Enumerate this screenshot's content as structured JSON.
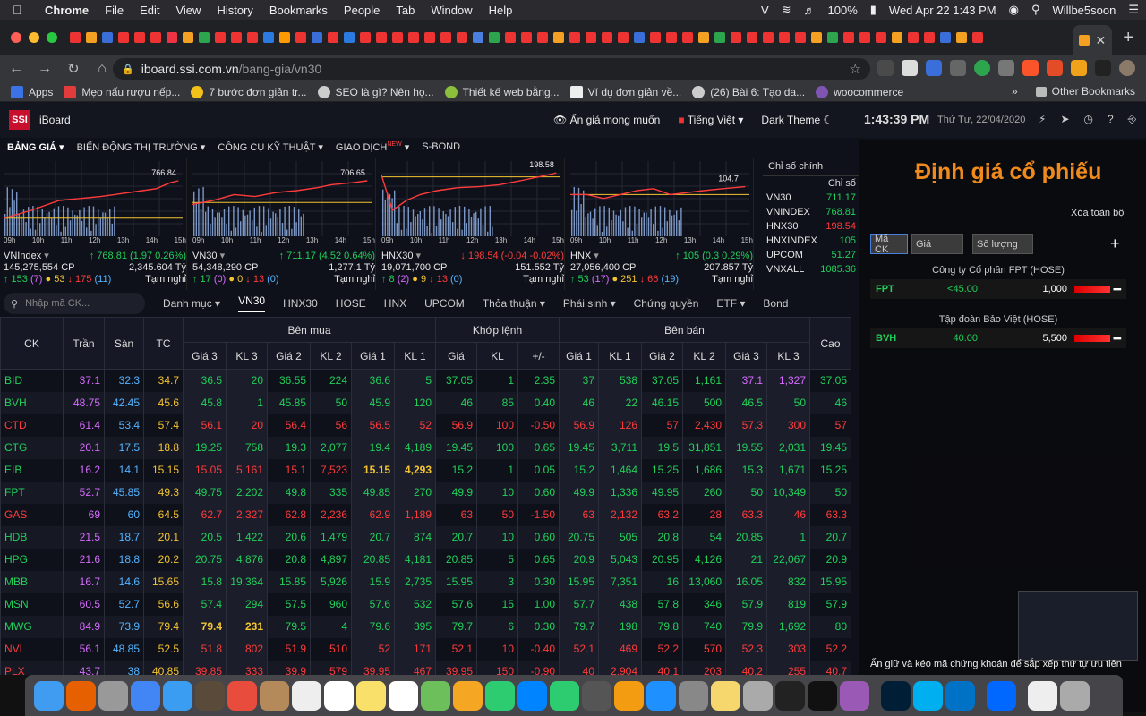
{
  "menubar": {
    "app": "Chrome",
    "items": [
      "File",
      "Edit",
      "View",
      "History",
      "Bookmarks",
      "People",
      "Tab",
      "Window",
      "Help"
    ],
    "battery": "100%",
    "datetime": "Wed Apr 22  1:43 PM",
    "user": "Willbe5soon"
  },
  "browser": {
    "url_host": "iboard.ssi.com.vn",
    "url_path": "/bang-gia/vn30"
  },
  "bookmarks": {
    "items": [
      "Apps",
      "Mẹo nấu rượu nếp...",
      "7 bước đơn giản tr...",
      "SEO là gì? Nên họ...",
      "Thiết kế web bằng...",
      "Ví dụ đơn giản về...",
      "(26) Bài 6: Tạo da...",
      "woocommerce"
    ],
    "more": "»",
    "other": "Other Bookmarks"
  },
  "header": {
    "brand": "iBoard",
    "logo": "SSI",
    "hide_price": "Ẩn giá mong muốn",
    "language": "Tiếng Việt",
    "theme": "Dark Theme",
    "time": "1:43:39 PM",
    "date": "Thứ Tư, 22/04/2020"
  },
  "nav": {
    "items": [
      "BẢNG GIÁ",
      "BIẾN ĐỘNG THỊ TRƯỜNG",
      "CÔNG CỤ KỸ THUẬT",
      "GIAO DỊCH",
      "S-BOND"
    ],
    "new_tag": "NEW"
  },
  "index_charts": [
    {
      "name": "VNIndex",
      "peak": "766.84",
      "change": "↑ 768.81 (1.97 0.26%)",
      "volume": "145,275,554 CP",
      "value": "2,345.604 Tỷ",
      "adv": "↑ 153",
      "adv_ce": "(7)",
      "ref": "53",
      "dec": "↓ 175",
      "dec_fl": "(11)",
      "status": "Tạm nghỉ",
      "ticks": [
        "09h",
        "10h",
        "11h",
        "12h",
        "13h",
        "14h",
        "15h"
      ]
    },
    {
      "name": "VN30",
      "peak": "706.65",
      "change": "↑ 711.17 (4.52 0.64%)",
      "volume": "54,348,290 CP",
      "value": "1,277.1 Tỷ",
      "adv": "↑ 17",
      "adv_ce": "(0)",
      "ref": "0",
      "dec": "↓ 13",
      "dec_fl": "(0)",
      "status": "Tạm nghỉ",
      "ticks": [
        "09h",
        "10h",
        "11h",
        "12h",
        "13h",
        "14h",
        "15h"
      ]
    },
    {
      "name": "HNX30",
      "peak": "198.58",
      "change": "↓ 198.54 (-0.04 -0.02%)",
      "volume": "19,071,700 CP",
      "value": "151.552 Tỷ",
      "adv": "↑ 8",
      "adv_ce": "(2)",
      "ref": "9",
      "dec": "↓ 13",
      "dec_fl": "(0)",
      "status": "Tạm nghỉ",
      "ticks": [
        "09h",
        "10h",
        "11h",
        "12h",
        "13h",
        "14h",
        "15h"
      ]
    },
    {
      "name": "HNX",
      "peak": "104.7",
      "change": "↑ 105 (0.3 0.29%)",
      "volume": "27,056,400 CP",
      "value": "207.857 Tỷ",
      "adv": "↑ 53",
      "adv_ce": "(17)",
      "ref": "251",
      "dec": "↓ 66",
      "dec_fl": "(19)",
      "status": "Tạm nghỉ",
      "ticks": [
        "09h",
        "10h",
        "11h",
        "12h",
        "13h",
        "14h",
        "15h"
      ]
    }
  ],
  "index_panel": {
    "title": "Chỉ số chính",
    "header": "Chỉ số",
    "rows": [
      {
        "name": "VN30",
        "value": "711.17",
        "color": "#21d05a"
      },
      {
        "name": "VNINDEX",
        "value": "768.81",
        "color": "#21d05a"
      },
      {
        "name": "HNX30",
        "value": "198.54",
        "color": "#ff3b3b"
      },
      {
        "name": "HNXINDEX",
        "value": "105",
        "color": "#21d05a"
      },
      {
        "name": "UPCOM",
        "value": "51.27",
        "color": "#21d05a"
      },
      {
        "name": "VNXALL",
        "value": "1085.36",
        "color": "#21d05a"
      }
    ]
  },
  "tabs": {
    "search_placeholder": "Nhập mã CK...",
    "items": [
      "Danh mục",
      "VN30",
      "HNX30",
      "HOSE",
      "HNX",
      "UPCOM",
      "Thỏa thuận",
      "Phái sinh",
      "Chứng quyền",
      "ETF",
      "Bond"
    ]
  },
  "table": {
    "headers": {
      "ck": "CK",
      "tran": "Trần",
      "san": "Sàn",
      "tc": "TC",
      "ben_mua": "Bên mua",
      "khop": "Khớp lệnh",
      "ben_ban": "Bên bán",
      "cao": "Cao"
    },
    "sub": [
      "Giá 3",
      "KL 3",
      "Giá 2",
      "KL 2",
      "Giá 1",
      "KL 1",
      "Giá",
      "KL",
      "+/-",
      "Giá 1",
      "KL 1",
      "Giá 2",
      "KL 2",
      "Giá 3",
      "KL 3"
    ],
    "rows": [
      {
        "c": [
          "BID",
          "37.1",
          "32.3",
          "34.7",
          "36.5",
          "20",
          "36.55",
          "224",
          "36.6",
          "5",
          "37.05",
          "1",
          "2.35",
          "37",
          "538",
          "37.05",
          "1,161",
          "37.1",
          "1,327",
          "37.05"
        ],
        "k": [
          "up",
          "ce",
          "fl",
          "ref",
          "up",
          "up",
          "up",
          "up",
          "up",
          "up",
          "up",
          "up",
          "up",
          "up",
          "up",
          "up",
          "up",
          "ce",
          "ce",
          "up"
        ]
      },
      {
        "c": [
          "BVH",
          "48.75",
          "42.45",
          "45.6",
          "45.8",
          "1",
          "45.85",
          "50",
          "45.9",
          "120",
          "46",
          "85",
          "0.40",
          "46",
          "22",
          "46.15",
          "500",
          "46.5",
          "50",
          "46"
        ],
        "k": [
          "up",
          "ce",
          "fl",
          "ref",
          "up",
          "up",
          "up",
          "up",
          "up",
          "up",
          "up",
          "up",
          "up",
          "up",
          "up",
          "up",
          "up",
          "up",
          "up",
          "up"
        ]
      },
      {
        "c": [
          "CTD",
          "61.4",
          "53.4",
          "57.4",
          "56.1",
          "20",
          "56.4",
          "56",
          "56.5",
          "52",
          "56.9",
          "100",
          "-0.50",
          "56.9",
          "126",
          "57",
          "2,430",
          "57.3",
          "300",
          "57"
        ],
        "k": [
          "dn",
          "ce",
          "fl",
          "ref",
          "dn",
          "dn",
          "dn",
          "dn",
          "dn",
          "dn",
          "dn",
          "dn",
          "dn",
          "dn",
          "dn",
          "dn",
          "dn",
          "dn",
          "dn",
          "dn"
        ]
      },
      {
        "c": [
          "CTG",
          "20.1",
          "17.5",
          "18.8",
          "19.25",
          "758",
          "19.3",
          "2,077",
          "19.4",
          "4,189",
          "19.45",
          "100",
          "0.65",
          "19.45",
          "3,711",
          "19.5",
          "31,851",
          "19.55",
          "2,031",
          "19.45"
        ],
        "k": [
          "up",
          "ce",
          "fl",
          "ref",
          "up",
          "up",
          "up",
          "up",
          "up",
          "up",
          "up",
          "up",
          "up",
          "up",
          "up",
          "up",
          "up",
          "up",
          "up",
          "up"
        ]
      },
      {
        "c": [
          "EIB",
          "16.2",
          "14.1",
          "15.15",
          "15.05",
          "5,161",
          "15.1",
          "7,523",
          "15.15",
          "4,293",
          "15.2",
          "1",
          "0.05",
          "15.2",
          "1,464",
          "15.25",
          "1,686",
          "15.3",
          "1,671",
          "15.25"
        ],
        "k": [
          "up",
          "ce",
          "fl",
          "ref",
          "dn",
          "dn",
          "dn",
          "dn",
          "ref",
          "ref",
          "up",
          "up",
          "up",
          "up",
          "up",
          "up",
          "up",
          "up",
          "up",
          "up"
        ]
      },
      {
        "c": [
          "FPT",
          "52.7",
          "45.85",
          "49.3",
          "49.75",
          "2,202",
          "49.8",
          "335",
          "49.85",
          "270",
          "49.9",
          "10",
          "0.60",
          "49.9",
          "1,336",
          "49.95",
          "260",
          "50",
          "10,349",
          "50"
        ],
        "k": [
          "up",
          "ce",
          "fl",
          "ref",
          "up",
          "up",
          "up",
          "up",
          "up",
          "up",
          "up",
          "up",
          "up",
          "up",
          "up",
          "up",
          "up",
          "up",
          "up",
          "up"
        ]
      },
      {
        "c": [
          "GAS",
          "69",
          "60",
          "64.5",
          "62.7",
          "2,327",
          "62.8",
          "2,236",
          "62.9",
          "1,189",
          "63",
          "50",
          "-1.50",
          "63",
          "2,132",
          "63.2",
          "28",
          "63.3",
          "46",
          "63.3"
        ],
        "k": [
          "dn",
          "ce",
          "fl",
          "ref",
          "dn",
          "dn",
          "dn",
          "dn",
          "dn",
          "dn",
          "dn",
          "dn",
          "dn",
          "dn",
          "dn",
          "dn",
          "dn",
          "dn",
          "dn",
          "dn"
        ]
      },
      {
        "c": [
          "HDB",
          "21.5",
          "18.7",
          "20.1",
          "20.5",
          "1,422",
          "20.6",
          "1,479",
          "20.7",
          "874",
          "20.7",
          "10",
          "0.60",
          "20.75",
          "505",
          "20.8",
          "54",
          "20.85",
          "1",
          "20.7"
        ],
        "k": [
          "up",
          "ce",
          "fl",
          "ref",
          "up",
          "up",
          "up",
          "up",
          "up",
          "up",
          "up",
          "up",
          "up",
          "up",
          "up",
          "up",
          "up",
          "up",
          "up",
          "up"
        ]
      },
      {
        "c": [
          "HPG",
          "21.6",
          "18.8",
          "20.2",
          "20.75",
          "4,876",
          "20.8",
          "4,897",
          "20.85",
          "4,181",
          "20.85",
          "5",
          "0.65",
          "20.9",
          "5,043",
          "20.95",
          "4,126",
          "21",
          "22,067",
          "20.9"
        ],
        "k": [
          "up",
          "ce",
          "fl",
          "ref",
          "up",
          "up",
          "up",
          "up",
          "up",
          "up",
          "up",
          "up",
          "up",
          "up",
          "up",
          "up",
          "up",
          "up",
          "up",
          "up"
        ]
      },
      {
        "c": [
          "MBB",
          "16.7",
          "14.6",
          "15.65",
          "15.8",
          "19,364",
          "15.85",
          "5,926",
          "15.9",
          "2,735",
          "15.95",
          "3",
          "0.30",
          "15.95",
          "7,351",
          "16",
          "13,060",
          "16.05",
          "832",
          "15.95"
        ],
        "k": [
          "up",
          "ce",
          "fl",
          "ref",
          "up",
          "up",
          "up",
          "up",
          "up",
          "up",
          "up",
          "up",
          "up",
          "up",
          "up",
          "up",
          "up",
          "up",
          "up",
          "up"
        ]
      },
      {
        "c": [
          "MSN",
          "60.5",
          "52.7",
          "56.6",
          "57.4",
          "294",
          "57.5",
          "960",
          "57.6",
          "532",
          "57.6",
          "15",
          "1.00",
          "57.7",
          "438",
          "57.8",
          "346",
          "57.9",
          "819",
          "57.9"
        ],
        "k": [
          "up",
          "ce",
          "fl",
          "ref",
          "up",
          "up",
          "up",
          "up",
          "up",
          "up",
          "up",
          "up",
          "up",
          "up",
          "up",
          "up",
          "up",
          "up",
          "up",
          "up"
        ]
      },
      {
        "c": [
          "MWG",
          "84.9",
          "73.9",
          "79.4",
          "79.4",
          "231",
          "79.5",
          "4",
          "79.6",
          "395",
          "79.7",
          "6",
          "0.30",
          "79.7",
          "198",
          "79.8",
          "740",
          "79.9",
          "1,692",
          "80"
        ],
        "k": [
          "up",
          "ce",
          "fl",
          "ref",
          "ref",
          "ref",
          "up",
          "up",
          "up",
          "up",
          "up",
          "up",
          "up",
          "up",
          "up",
          "up",
          "up",
          "up",
          "up",
          "up"
        ]
      },
      {
        "c": [
          "NVL",
          "56.1",
          "48.85",
          "52.5",
          "51.8",
          "802",
          "51.9",
          "510",
          "52",
          "171",
          "52.1",
          "10",
          "-0.40",
          "52.1",
          "469",
          "52.2",
          "570",
          "52.3",
          "303",
          "52.2"
        ],
        "k": [
          "dn",
          "ce",
          "fl",
          "ref",
          "dn",
          "dn",
          "dn",
          "dn",
          "dn",
          "dn",
          "dn",
          "dn",
          "dn",
          "dn",
          "dn",
          "dn",
          "dn",
          "dn",
          "dn",
          "dn"
        ]
      },
      {
        "c": [
          "PLX",
          "43.7",
          "38",
          "40.85",
          "39.85",
          "333",
          "39.9",
          "579",
          "39.95",
          "467",
          "39.95",
          "150",
          "-0.90",
          "40",
          "2,904",
          "40.1",
          "203",
          "40.2",
          "255",
          "40.7"
        ],
        "k": [
          "dn",
          "ce",
          "fl",
          "ref",
          "dn",
          "dn",
          "dn",
          "dn",
          "dn",
          "dn",
          "dn",
          "dn",
          "dn",
          "dn",
          "dn",
          "dn",
          "dn",
          "dn",
          "dn",
          "dn"
        ]
      }
    ]
  },
  "valuation": {
    "title": "Định giá cổ phiếu",
    "clear": "Xóa toàn bộ",
    "placeholders": [
      "Mã CK",
      "Giá",
      "Số lượng"
    ],
    "items": [
      {
        "company": "Công ty Cổ phần FPT (HOSE)",
        "symbol": "FPT",
        "price": "<45.00",
        "qty": "1,000"
      },
      {
        "company": "Tập đoàn Bảo Việt (HOSE)",
        "symbol": "BVH",
        "price": "40.00",
        "qty": "5,500"
      }
    ],
    "footer": "Ấn giữ và kéo mã chứng khoán để sắp xếp thứ tự ưu tiên"
  }
}
